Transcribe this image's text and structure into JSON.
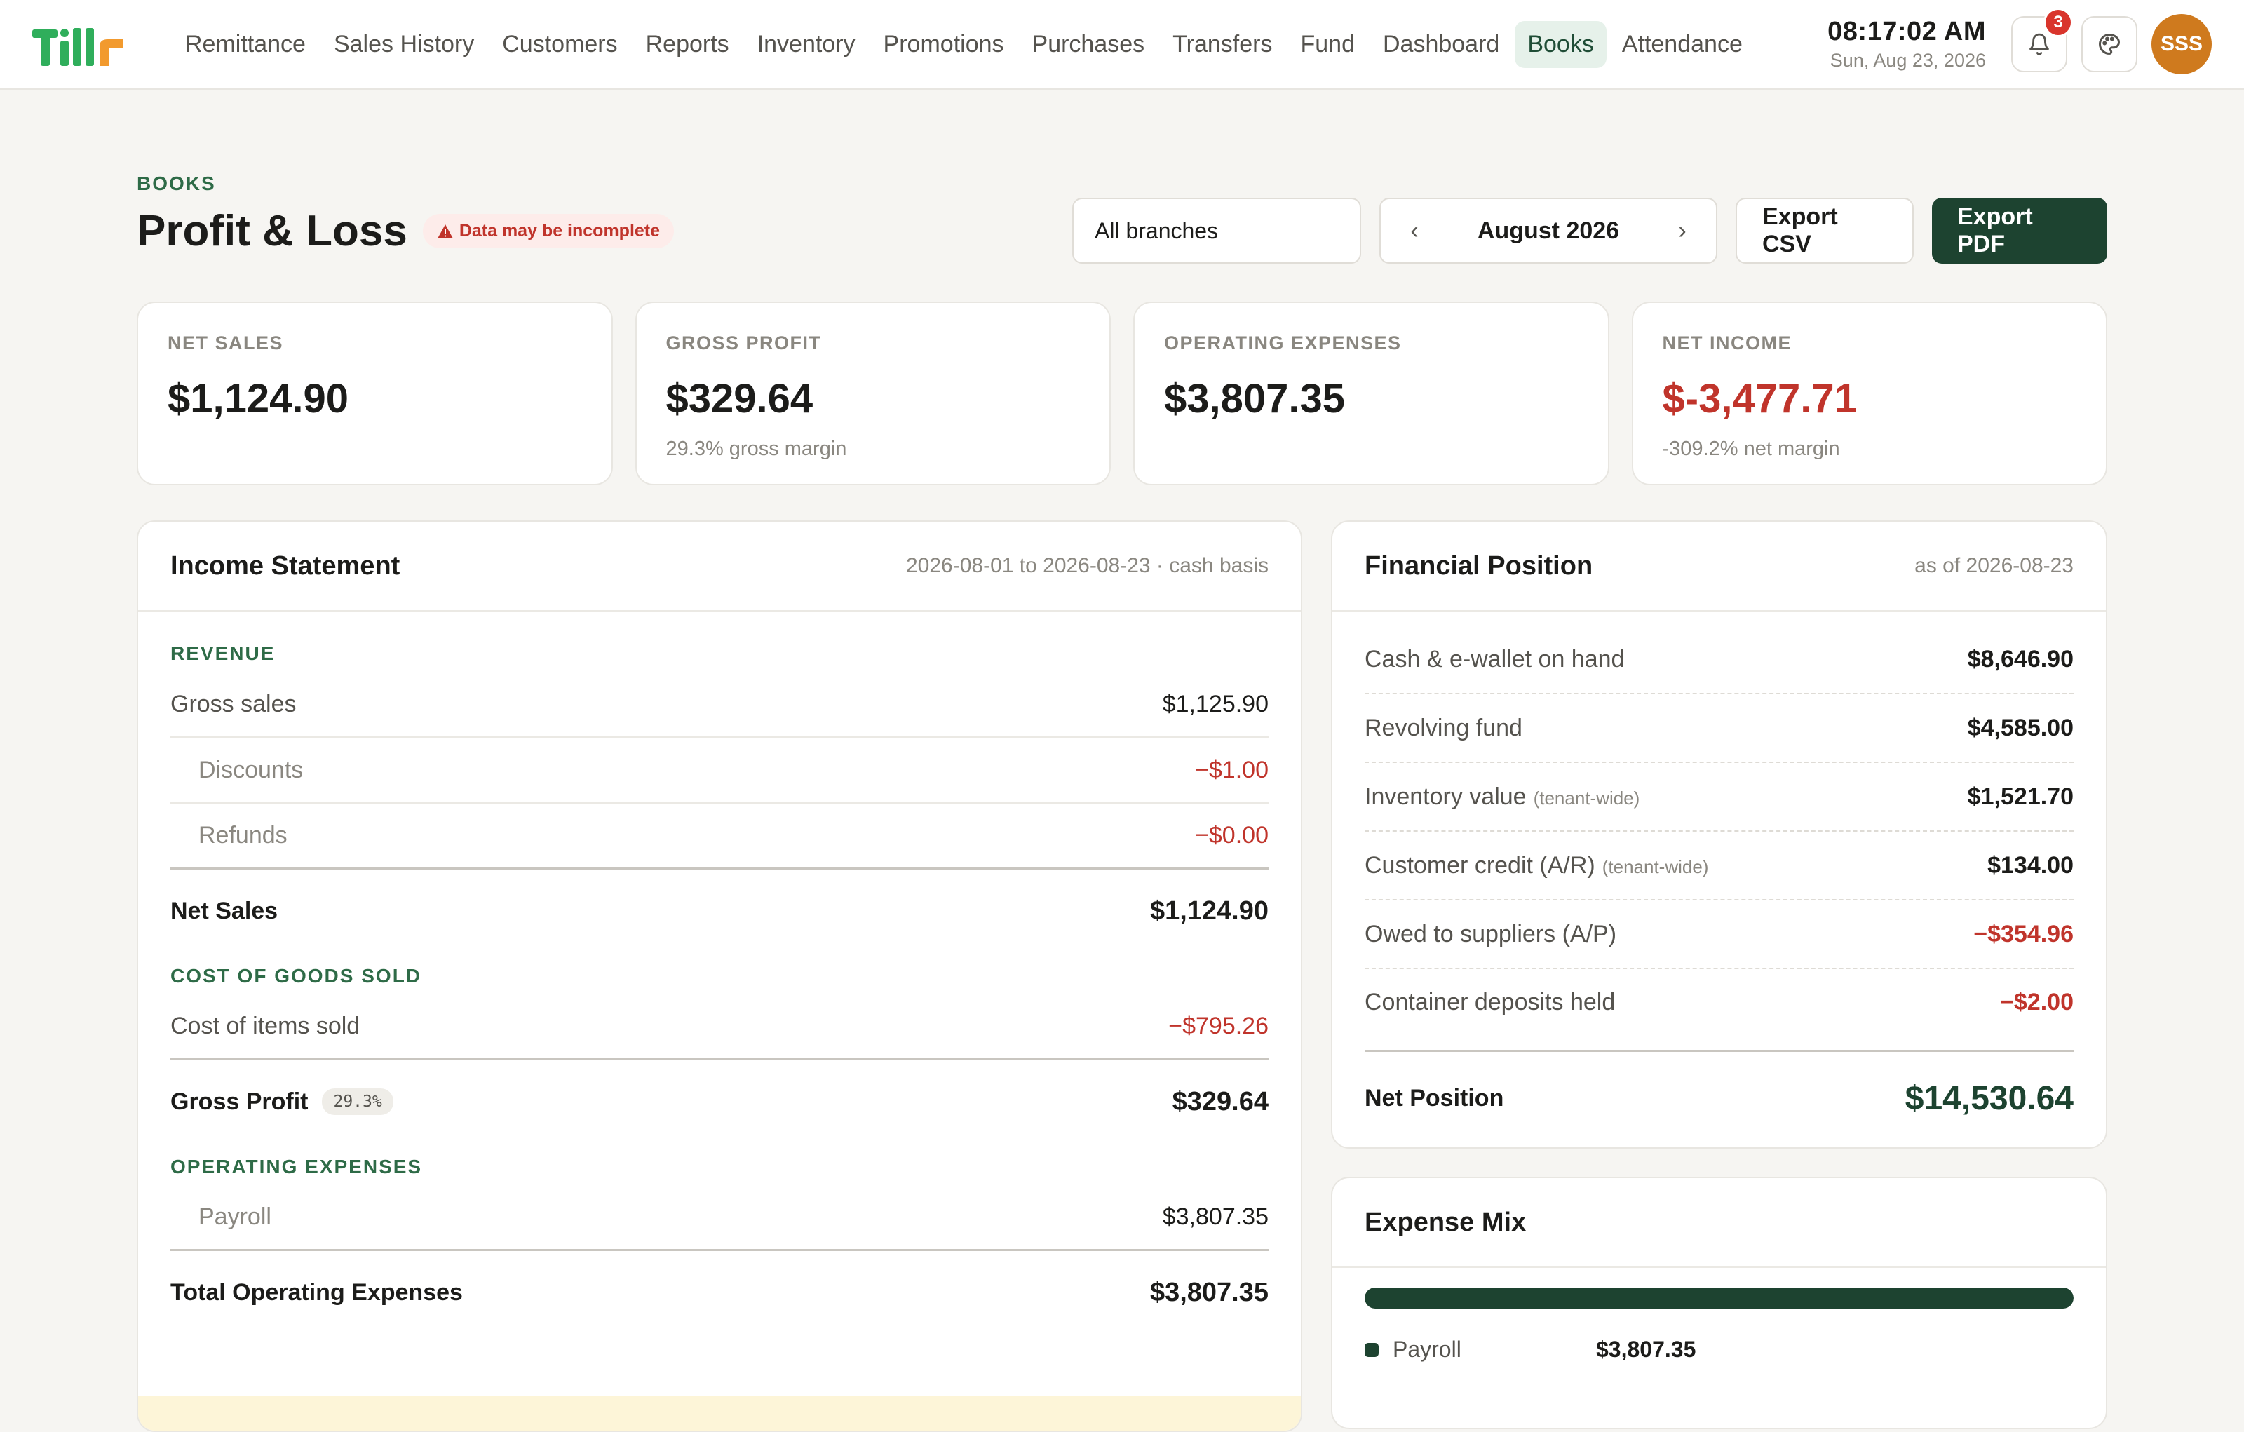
{
  "app": {
    "name": "Tillr"
  },
  "nav": {
    "items": [
      {
        "label": "Remittance",
        "active": false
      },
      {
        "label": "Sales History",
        "active": false
      },
      {
        "label": "Customers",
        "active": false
      },
      {
        "label": "Reports",
        "active": false
      },
      {
        "label": "Inventory",
        "active": false
      },
      {
        "label": "Promotions",
        "active": false
      },
      {
        "label": "Purchases",
        "active": false
      },
      {
        "label": "Transfers",
        "active": false
      },
      {
        "label": "Fund",
        "active": false
      },
      {
        "label": "Dashboard",
        "active": false
      },
      {
        "label": "Books",
        "active": true
      },
      {
        "label": "Attendance",
        "active": false
      }
    ]
  },
  "header": {
    "time": "08:17:02 AM",
    "date": "Sun, Aug 23, 2026",
    "notification_count": "3",
    "notification_icon": "bell-icon",
    "theme_icon": "palette-icon",
    "avatar_initials": "SSS",
    "avatar_color": "#cf7a1e"
  },
  "page": {
    "eyebrow": "BOOKS",
    "title": "Profit & Loss",
    "warning": "Data may be incomplete",
    "branch_select": "All branches",
    "month": "August 2026",
    "prev_label": "‹",
    "next_label": "›",
    "export_csv": "Export CSV",
    "export_pdf": "Export PDF",
    "accent_color": "#1d4330",
    "negative_color": "#c0342b"
  },
  "kpis": [
    {
      "label": "NET SALES",
      "value": "$1,124.90",
      "sub": "",
      "negative": false
    },
    {
      "label": "GROSS PROFIT",
      "value": "$329.64",
      "sub": "29.3% gross margin",
      "negative": false
    },
    {
      "label": "OPERATING EXPENSES",
      "value": "$3,807.35",
      "sub": "",
      "negative": false
    },
    {
      "label": "NET INCOME",
      "value": "$-3,477.71",
      "sub": "-309.2% net margin",
      "negative": true
    }
  ],
  "income": {
    "title": "Income Statement",
    "meta": "2026-08-01 to 2026-08-23 · cash basis",
    "revenue_label": "REVENUE",
    "gross_sales": {
      "label": "Gross sales",
      "value": "$1,125.90"
    },
    "discounts": {
      "label": "Discounts",
      "value": "−$1.00"
    },
    "refunds": {
      "label": "Refunds",
      "value": "−$0.00"
    },
    "net_sales": {
      "label": "Net Sales",
      "value": "$1,124.90"
    },
    "cogs_label": "COST OF GOODS SOLD",
    "cost_items": {
      "label": "Cost of items sold",
      "value": "−$795.26"
    },
    "gross_profit": {
      "label": "Gross Profit",
      "pct": "29.3%",
      "value": "$329.64"
    },
    "opex_label": "OPERATING EXPENSES",
    "payroll": {
      "label": "Payroll",
      "value": "$3,807.35"
    },
    "total_opex": {
      "label": "Total Operating Expenses",
      "value": "$3,807.35"
    }
  },
  "financial": {
    "title": "Financial Position",
    "meta": "as of 2026-08-23",
    "rows": [
      {
        "label": "Cash & e-wallet on hand",
        "note": "",
        "value": "$8,646.90",
        "negative": false
      },
      {
        "label": "Revolving fund",
        "note": "",
        "value": "$4,585.00",
        "negative": false
      },
      {
        "label": "Inventory value",
        "note": "(tenant-wide)",
        "value": "$1,521.70",
        "negative": false
      },
      {
        "label": "Customer credit (A/R)",
        "note": "(tenant-wide)",
        "value": "$134.00",
        "negative": false
      },
      {
        "label": "Owed to suppliers (A/P)",
        "note": "",
        "value": "−$354.96",
        "negative": true
      },
      {
        "label": "Container deposits held",
        "note": "",
        "value": "−$2.00",
        "negative": true
      }
    ],
    "net_label": "Net Position",
    "net_value": "$14,530.64"
  },
  "expense_mix": {
    "title": "Expense Mix",
    "items": [
      {
        "name": "Payroll",
        "value": "$3,807.35",
        "share": 1.0,
        "color": "#1d4330"
      }
    ]
  }
}
